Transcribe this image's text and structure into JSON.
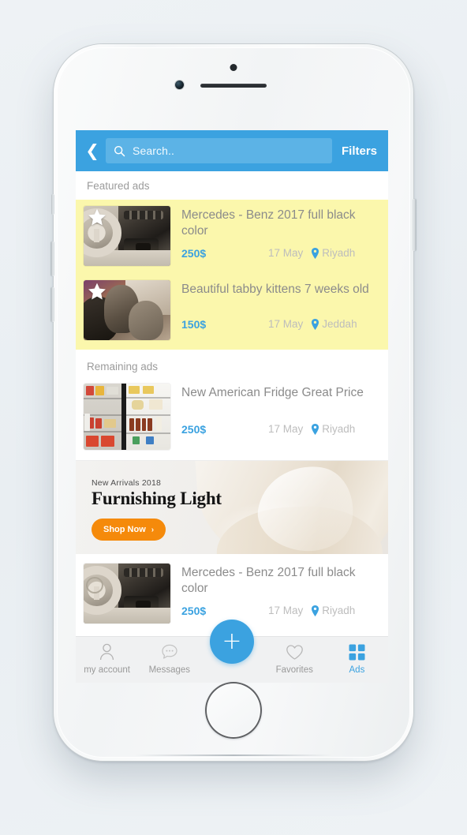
{
  "app": {
    "header": {
      "back_icon": "chevron-left-icon",
      "search_placeholder": "Search..",
      "search_icon": "search-icon",
      "filters_label": "Filters",
      "bg_color": "#3ba2e0"
    },
    "sections": [
      {
        "id": "featured",
        "label": "Featured ads"
      },
      {
        "id": "remaining",
        "label": "Remaining ads"
      }
    ],
    "featured_ads": [
      {
        "title": "Mercedes - Benz 2017 full black color",
        "price": "250$",
        "date": "17 May",
        "location": "Riyadh",
        "badge": "star-badge",
        "image": "mercedes-benz-interior"
      },
      {
        "title": "Beautiful tabby kittens 7 weeks old",
        "price": "150$",
        "date": "17 May",
        "location": "Jeddah",
        "badge": "star-badge",
        "image": "tabby-kittens"
      }
    ],
    "remaining_ads": [
      {
        "title": "New American Fridge Great Price",
        "price": "250$",
        "date": "17 May",
        "location": "Riyadh",
        "image": "american-fridge"
      },
      {
        "title": "Mercedes - Benz 2017 full black color",
        "price": "250$",
        "date": "17 May",
        "location": "Riyadh",
        "image": "mercedes-benz-interior"
      }
    ],
    "promo_banner": {
      "kicker": "New Arrivals 2018",
      "title": "Furnishing Light",
      "cta_label": "Shop Now",
      "cta_chevron": "›",
      "cta_color": "#f58a0b"
    },
    "tabbar": {
      "items": [
        {
          "id": "my-account",
          "label": "my account",
          "icon": "person-icon",
          "active": false
        },
        {
          "id": "messages",
          "label": "Messages",
          "icon": "chat-bubble-icon",
          "active": false
        },
        {
          "id": "favorites",
          "label": "Favorites",
          "icon": "heart-icon",
          "active": false
        },
        {
          "id": "ads",
          "label": "Ads",
          "icon": "grid-icon",
          "active": true
        }
      ],
      "fab": {
        "icon": "plus-icon",
        "label": "+",
        "color": "#3ba2e0"
      },
      "active_color": "#3ba2e0",
      "inactive_color": "#9a9a9a"
    },
    "colors": {
      "accent": "#3ba2e0",
      "featured_bg": "#fbf7ac",
      "price": "#3ba2e0",
      "title_text": "#8b8b8b",
      "meta_text": "#bdbdbd"
    }
  }
}
